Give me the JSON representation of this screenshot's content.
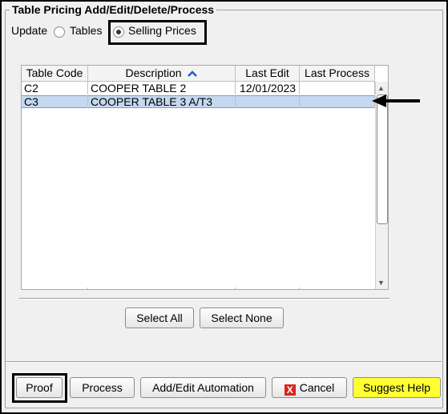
{
  "panel": {
    "title": "Table Pricing Add/Edit/Delete/Process"
  },
  "update": {
    "label": "Update",
    "options": [
      {
        "label": "Tables",
        "selected": false
      },
      {
        "label": "Selling Prices",
        "selected": true
      }
    ]
  },
  "grid": {
    "columns": [
      "Table Code",
      "Description",
      "Last Edit",
      "Last Process"
    ],
    "sort_column": "Description",
    "sort_direction": "ascending",
    "rows": [
      {
        "code": "C2",
        "description": "COOPER TABLE 2",
        "last_edit": "12/01/2023",
        "last_process": "",
        "selected": false
      },
      {
        "code": "C3",
        "description": "COOPER TABLE 3 A/T3",
        "last_edit": "",
        "last_process": "",
        "selected": true
      }
    ]
  },
  "selection_buttons": {
    "select_all": "Select All",
    "select_none": "Select None"
  },
  "footer": {
    "proof": "Proof",
    "process": "Process",
    "automation": "Add/Edit Automation",
    "cancel": "Cancel",
    "suggest_help": "Suggest Help"
  },
  "colors": {
    "selected_row": "#c5d8ef",
    "suggest_help_bg": "#ffff33",
    "cancel_icon": "#d9261c",
    "sort_arrow": "#1a5fcc"
  }
}
